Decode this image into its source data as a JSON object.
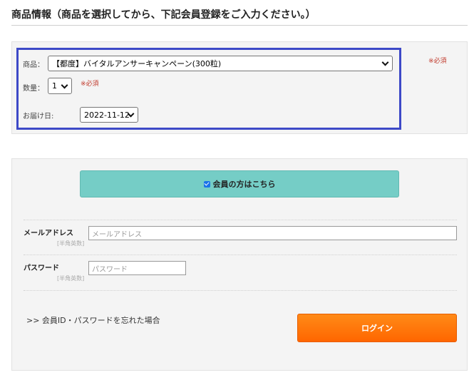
{
  "header": {
    "title": "商品情報（商品を選択してから、下記会員登録をご入力ください。）"
  },
  "product_form": {
    "product_label": "商品：",
    "product_value": "【都度】バイタルアンサーキャンペーン(300粒)",
    "quantity_label": "数量：",
    "quantity_value": "1",
    "quantity_required": "※必須",
    "date_label": "お届け日:",
    "date_value": "2022-11-12",
    "outer_required": "※必須"
  },
  "login": {
    "member_toggle_label": "会員の方はこちら",
    "email_label": "メールアドレス",
    "email_note": "[半角英数]",
    "email_placeholder": "メールアドレス",
    "password_label": "パスワード",
    "password_note": "[半角英数]",
    "password_placeholder": "パスワード",
    "forgot_link": ">> 会員ID・パスワードを忘れた場合",
    "login_button": "ログイン"
  },
  "colors": {
    "highlight_border": "#3d49c7",
    "member_bar": "#75cdc6",
    "login_button": "#ff7a0a",
    "required_text": "#c0392b"
  }
}
